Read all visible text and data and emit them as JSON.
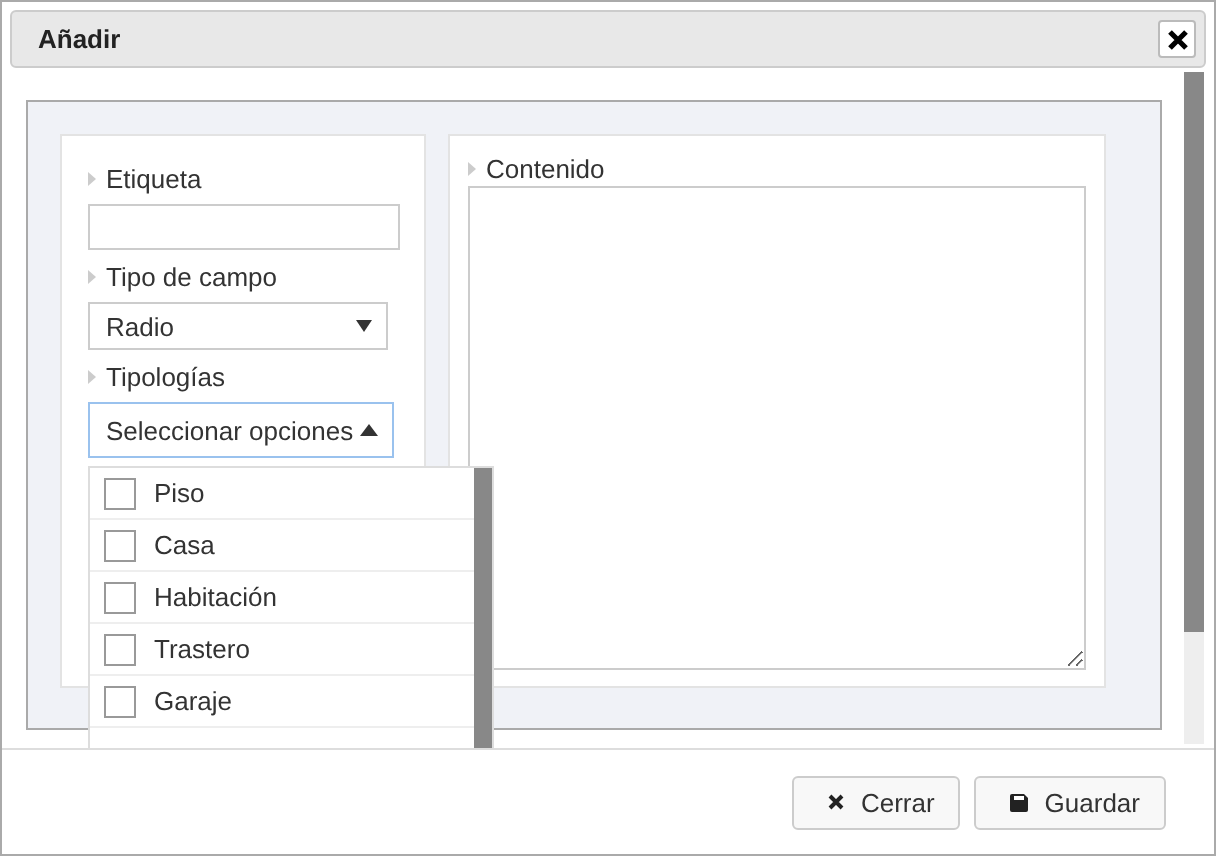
{
  "window": {
    "title": "Añadir"
  },
  "fields": [
    {
      "kind": "text",
      "label": "Etiqueta"
    },
    {
      "kind": "select",
      "label": "Tipo de campo",
      "value": "Radio"
    },
    {
      "kind": "multiselect",
      "label": "Tipologías",
      "value": "Seleccionar opciones",
      "expanded": true
    }
  ],
  "options": [
    {
      "label": "Piso",
      "checked": false
    },
    {
      "label": "Casa",
      "checked": false
    },
    {
      "label": "Habitación",
      "checked": false
    },
    {
      "label": "Trastero",
      "checked": false
    },
    {
      "label": "Garaje",
      "checked": false
    }
  ],
  "content": {
    "label": "Contenido"
  },
  "buttons": [
    {
      "kind": "close",
      "label": "Cerrar"
    },
    {
      "kind": "save",
      "label": "Guardar"
    }
  ]
}
